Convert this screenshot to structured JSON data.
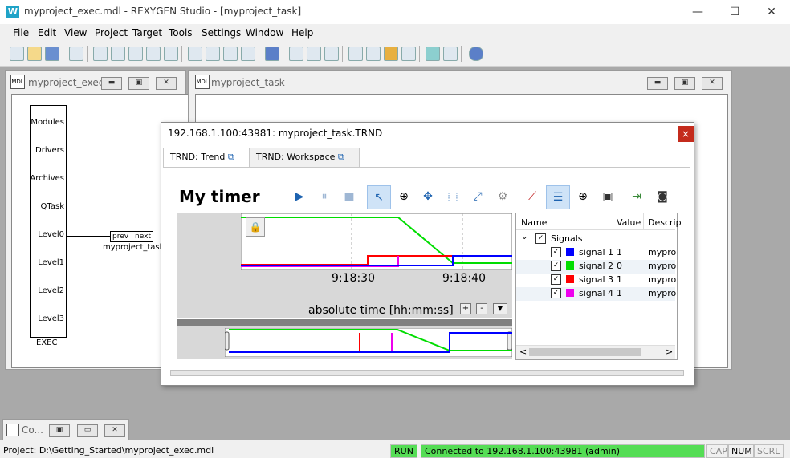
{
  "app": {
    "title": "myproject_exec.mdl - REXYGEN Studio - [myproject_task]",
    "logo": "W",
    "window_controls": {
      "minimize": "—",
      "maximize": "☐",
      "close": "✕"
    }
  },
  "menu": [
    "File",
    "Edit",
    "View",
    "Project",
    "Target",
    "Tools",
    "Settings",
    "Window",
    "Help"
  ],
  "exec_window": {
    "title": "myproject_exec",
    "ports": [
      "Modules",
      "Drivers",
      "Archives",
      "QTask",
      "Level0",
      "Level1",
      "Level2",
      "Level3"
    ],
    "block_label": "EXEC",
    "task_ports": {
      "prev": "prev",
      "next": "next"
    },
    "task_name": "myproject_task"
  },
  "task_window": {
    "title": "myproject_task"
  },
  "minimized_window": {
    "title": "Co..."
  },
  "trend_dialog": {
    "title": "192.168.1.100:43981: myproject_task.TRND",
    "close": "×",
    "tabs": [
      {
        "label": "TRND: Trend",
        "active": true
      },
      {
        "label": "TRND: Workspace",
        "active": false
      }
    ],
    "trend_title": "My timer",
    "time_ticks": [
      "9:18:30",
      "9:18:40"
    ],
    "axis_label": "absolute time [hh:mm:ss]",
    "zoom_buttons": [
      "+",
      "-",
      "▼"
    ],
    "lock_icon": "🔒",
    "columns": [
      "Name",
      "Value",
      "Descrip"
    ],
    "group": {
      "label": "Signals",
      "expanded_marker": "⌄"
    },
    "signals": [
      {
        "name": "signal 1",
        "value": "1",
        "color": "#0000ff",
        "desc": "mypro"
      },
      {
        "name": "signal 2",
        "value": "0",
        "color": "#00dd00",
        "desc": "mypro"
      },
      {
        "name": "signal 3",
        "value": "1",
        "color": "#ff0000",
        "desc": "mypro"
      },
      {
        "name": "signal 4",
        "value": "1",
        "color": "#ee00ee",
        "desc": "mypro"
      }
    ],
    "check": "✓",
    "scroll_left": "<",
    "scroll_right": ">"
  },
  "status": {
    "project": "Project: D:\\Getting_Started\\myproject_exec.mdl",
    "run": "RUN",
    "connected": "Connected to 192.168.1.100:43981 (admin)",
    "cap": "CAP",
    "num": "NUM",
    "scrl": "SCRL",
    "run_color": "#55dd55"
  }
}
